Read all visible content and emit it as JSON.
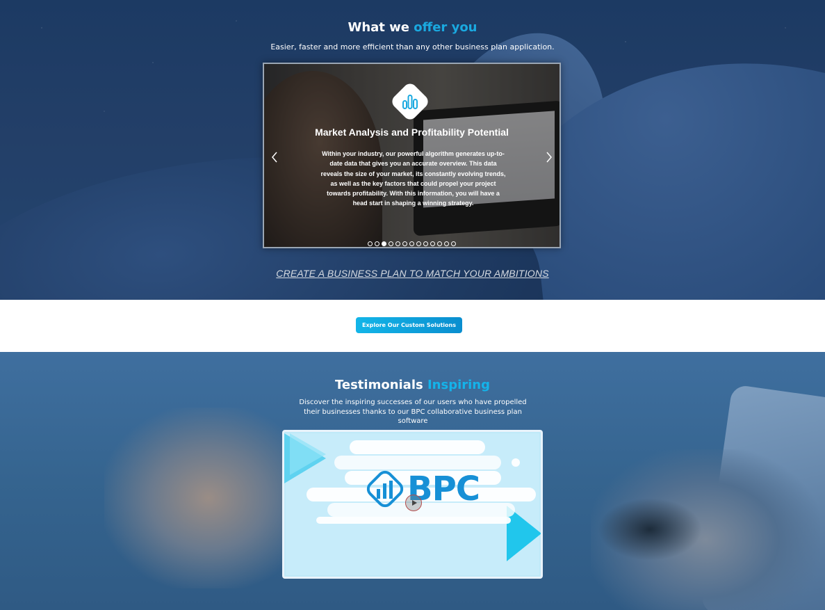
{
  "offer": {
    "title_main": "What we ",
    "title_accent": "offer you",
    "subtitle": "Easier, faster and more efficient than any other business plan application.",
    "slide": {
      "icon": "chart-bars-icon",
      "title": "Market Analysis and Profitability Potential",
      "text": "Within your industry, our powerful algorithm generates up-to-date data that gives you an accurate overview. This data reveals the size of your market, its constantly evolving trends, as well as the key factors that could propel your project towards profitability. With this information, you will have a head start in shaping a winning strategy."
    },
    "carousel": {
      "dot_count": 13,
      "active_index": 2
    },
    "cta_link": "CREATE A BUSINESS PLAN TO MATCH YOUR AMBITIONS"
  },
  "band": {
    "button_label": "Explore Our Custom Solutions"
  },
  "testimonials": {
    "title_main": "Testimonials ",
    "title_accent": "Inspiring",
    "subtitle": "Discover the inspiring successes of our users who have propelled their businesses thanks to our BPC collaborative business plan software",
    "video": {
      "brand_text": "BPC",
      "play_icon": "play-icon"
    }
  },
  "colors": {
    "accent": "#1aa9e0",
    "button_gradient_start": "#13b5e8",
    "button_gradient_end": "#0a8ecf",
    "bpc_blue": "#1790d6"
  }
}
